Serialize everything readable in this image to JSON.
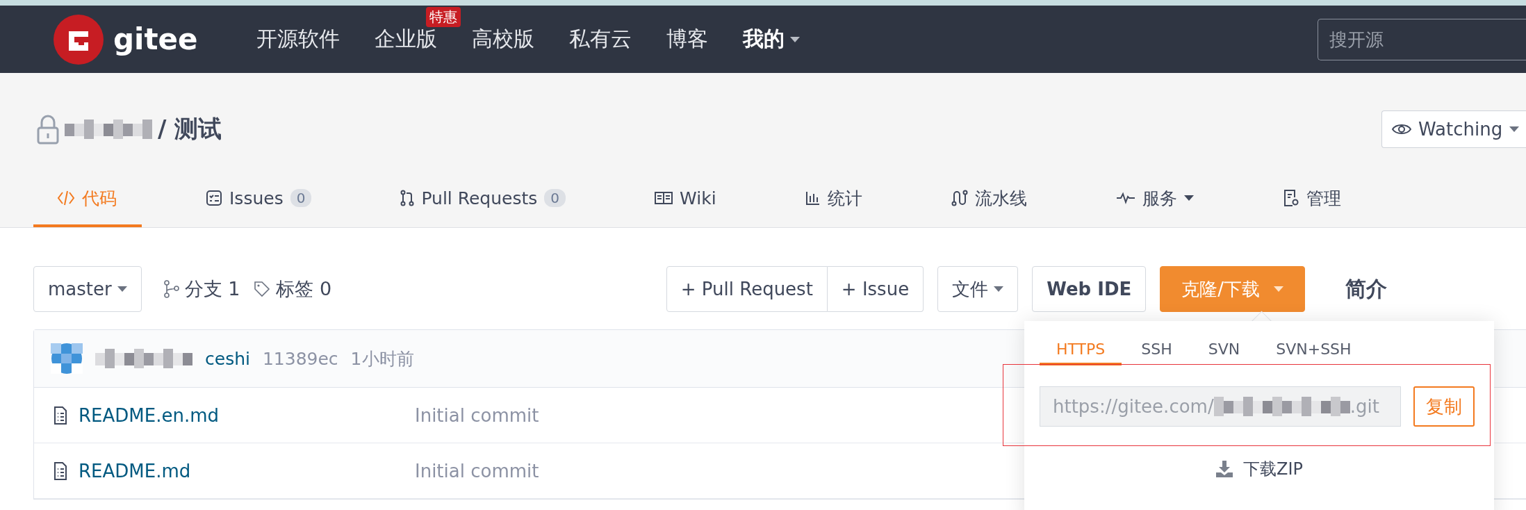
{
  "nav": {
    "logo": "gitee",
    "items": [
      {
        "label": "开源软件",
        "dropdown": false
      },
      {
        "label": "企业版",
        "badge": "特惠",
        "dropdown": false
      },
      {
        "label": "高校版",
        "dropdown": false
      },
      {
        "label": "私有云",
        "dropdown": false
      },
      {
        "label": "博客",
        "dropdown": false
      },
      {
        "label": "我的",
        "dropdown": true
      }
    ],
    "search": {
      "placeholder": "搜开源"
    }
  },
  "repo": {
    "name": "/ 测试",
    "watch": "Watching"
  },
  "tabs": [
    {
      "kind": "code",
      "label": "代码",
      "dropdown": false,
      "selected": true
    },
    {
      "kind": "issues",
      "label": "Issues",
      "count": "0",
      "dropdown": false,
      "selected": false
    },
    {
      "kind": "pulls",
      "label": "Pull Requests",
      "count": "0",
      "dropdown": false,
      "selected": false
    },
    {
      "kind": "wiki",
      "label": "Wiki",
      "dropdown": false,
      "selected": false
    },
    {
      "kind": "stats",
      "label": "统计",
      "dropdown": false,
      "selected": false
    },
    {
      "kind": "pipeline",
      "label": "流水线",
      "dropdown": false,
      "selected": false
    },
    {
      "kind": "services",
      "label": "服务",
      "dropdown": true,
      "selected": false
    },
    {
      "kind": "manage",
      "label": "管理",
      "dropdown": false,
      "selected": false
    }
  ],
  "toolbar": {
    "branch": "master",
    "branches": "分支 1",
    "tags": "标签 0",
    "new_pr": "+ Pull Request",
    "new_issue": "+ Issue",
    "files": "文件",
    "web_ide": "Web IDE",
    "clone": "克隆/下载",
    "about": "简介"
  },
  "commit": {
    "message": "ceshi",
    "hash": "11389ec",
    "time": "1小时前"
  },
  "files": [
    {
      "name": "README.en.md",
      "commit": "Initial commit"
    },
    {
      "name": "README.md",
      "commit": "Initial commit"
    }
  ],
  "clone_panel": {
    "tabs": [
      {
        "label": "HTTPS",
        "selected": true
      },
      {
        "label": "SSH",
        "selected": false
      },
      {
        "label": "SVN",
        "selected": false
      },
      {
        "label": "SVN+SSH",
        "selected": false
      }
    ],
    "url_start": "https://gitee.com/",
    "url_end": ".git",
    "copy": "复制",
    "download": "下载ZIP"
  }
}
